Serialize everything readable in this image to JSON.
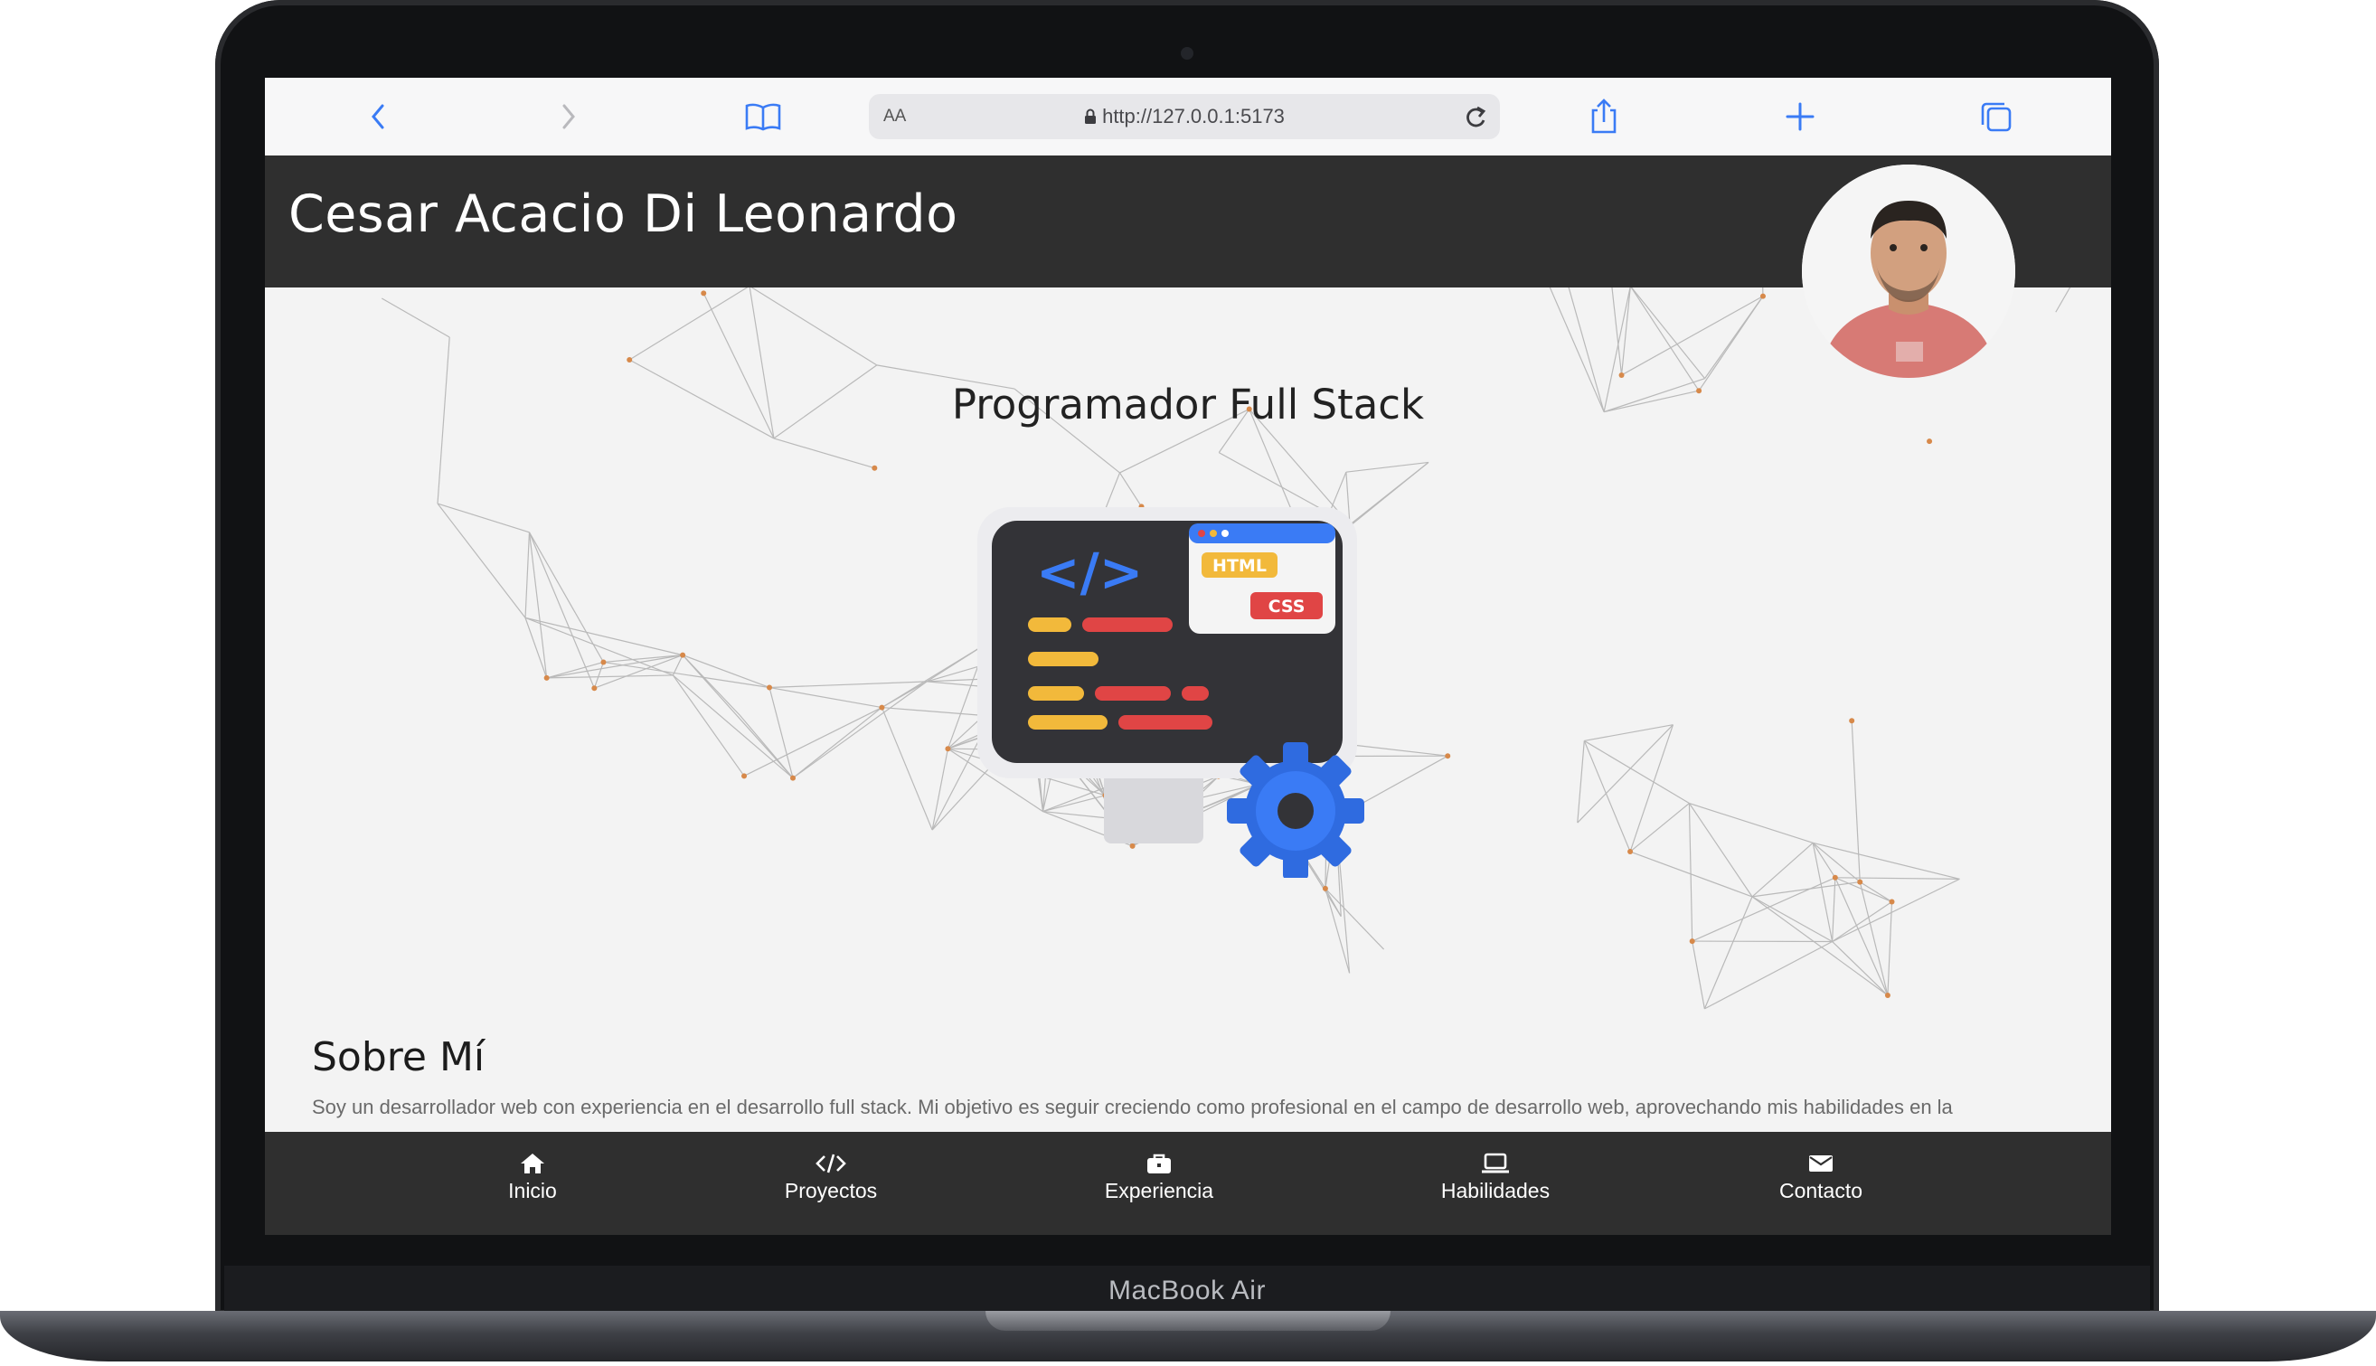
{
  "device": {
    "label": "MacBook Air"
  },
  "browser": {
    "text_size_label": "AA",
    "url": "http://127.0.0.1:5173",
    "icons": [
      "back-icon",
      "forward-icon",
      "reader-icon",
      "lock-icon",
      "reload-icon",
      "share-icon",
      "new-tab-icon",
      "tabs-icon"
    ]
  },
  "header": {
    "title": "Cesar Acacio Di Leonardo"
  },
  "hero": {
    "subtitle": "Programador Full Stack"
  },
  "illustration": {
    "html_badge": "HTML",
    "css_badge": "CSS",
    "code_symbol": "</>"
  },
  "about": {
    "title": "Sobre Mí",
    "text": "Soy un desarrollador web con experiencia en el desarrollo full stack. Mi objetivo es seguir creciendo como profesional en el campo de desarrollo web, aprovechando mis habilidades en la programación front-end y back-end para crear soluciones innovadoras y eficientes."
  },
  "nav": {
    "items": [
      {
        "label": "Inicio",
        "icon": "home-icon"
      },
      {
        "label": "Proyectos",
        "icon": "code-icon"
      },
      {
        "label": "Experiencia",
        "icon": "briefcase-icon"
      },
      {
        "label": "Habilidades",
        "icon": "laptop-icon"
      },
      {
        "label": "Contacto",
        "icon": "envelope-icon"
      }
    ]
  },
  "colors": {
    "header_bg": "#2f2f2f",
    "page_bg": "#f3f3f3",
    "browser_accent": "#3a7bf5",
    "network_node": "#d7894a"
  }
}
